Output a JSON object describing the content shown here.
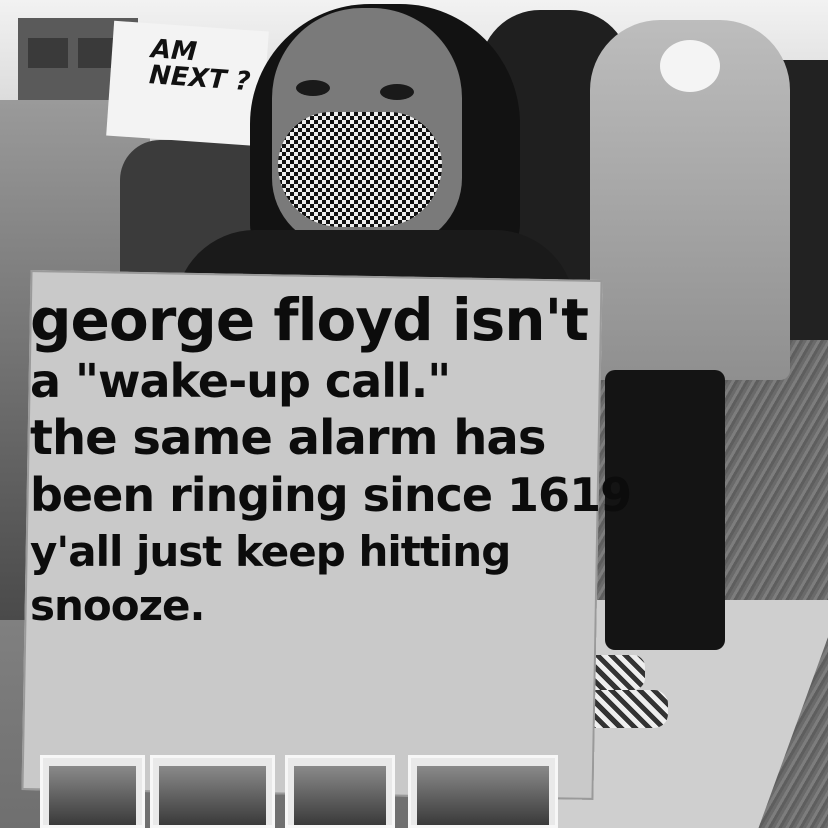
{
  "background_sign": {
    "text": "AM NEXT ?"
  },
  "placard": {
    "lines": [
      "george floyd isn't",
      "a \"wake-up call.\"",
      "the same alarm has",
      "been ringing since 1619",
      "y'all just keep hitting",
      "snooze."
    ]
  }
}
